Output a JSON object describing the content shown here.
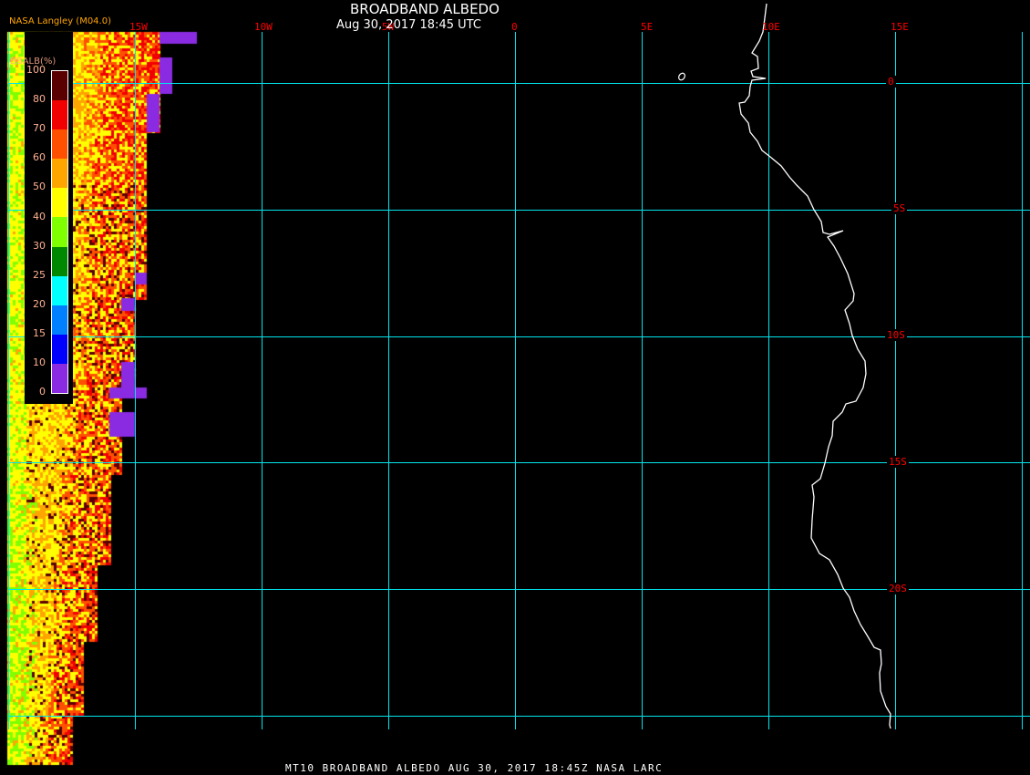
{
  "header": {
    "title": "BROADBAND ALBEDO",
    "datetime": "Aug 30, 2017 18:45 UTC",
    "credit": "NASA Langley (M04.0)"
  },
  "longitude_labels": [
    "15W",
    "10W",
    "5W",
    "0",
    "5E",
    "10E",
    "15E"
  ],
  "latitude_labels": [
    "0",
    "5S",
    "10S",
    "15S",
    "20S"
  ],
  "legend": {
    "title": "BBALB(%)",
    "ticks": [
      "100",
      "80",
      "70",
      "60",
      "50",
      "40",
      "30",
      "25",
      "20",
      "15",
      "10",
      "0"
    ],
    "colors": [
      "#5a0000",
      "#f00000",
      "#ff5000",
      "#ffa500",
      "#ffff00",
      "#80ff00",
      "#008800",
      "#00ffff",
      "#0080ff",
      "#0000ff",
      "#8a2be2"
    ]
  },
  "colors": {
    "grid": "#00e5ee",
    "coast": "#ffffff",
    "label": "#ff0000"
  },
  "footer": "MT10  BROADBAND ALBEDO   AUG 30, 2017 18:45Z   NASA LARC"
}
